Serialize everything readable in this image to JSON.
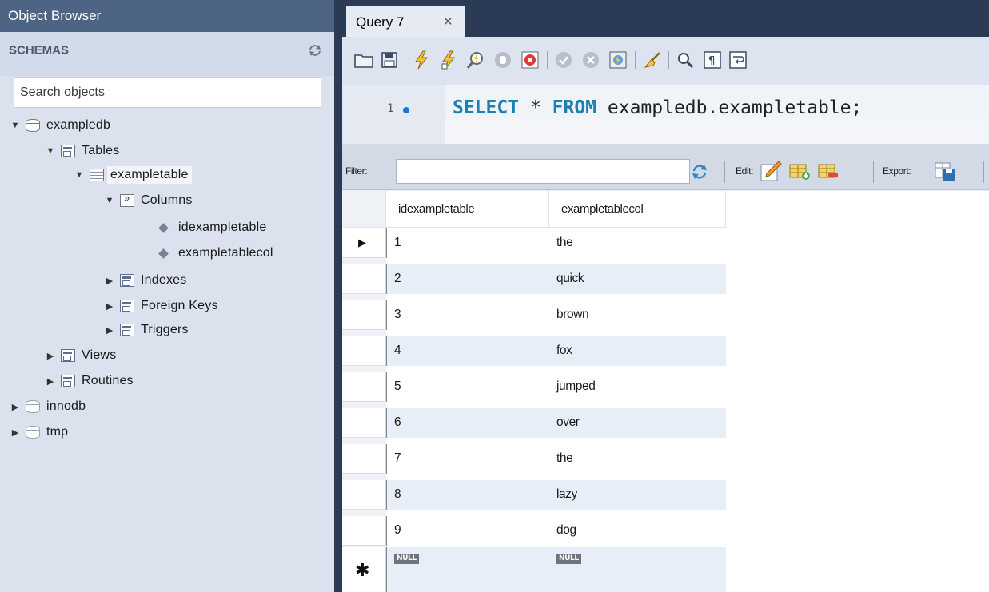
{
  "left_panel": {
    "title": "Object Browser",
    "schemas_label": "SCHEMAS",
    "search_placeholder": "Search objects",
    "tree": {
      "db": "exampledb",
      "tables": "Tables",
      "table": "exampletable",
      "columns": "Columns",
      "col1": "idexampletable",
      "col2": "exampletablecol",
      "indexes": "Indexes",
      "foreign_keys": "Foreign Keys",
      "triggers": "Triggers",
      "views": "Views",
      "routines": "Routines",
      "db2": "innodb",
      "db3": "tmp"
    }
  },
  "tab": {
    "label": "Query 7",
    "close": "✕"
  },
  "editor": {
    "line_number": "1",
    "kw_select": "SELECT",
    "star": " * ",
    "kw_from": "FROM",
    "rest": " exampledb.exampletable;"
  },
  "result_toolbar": {
    "filter_label": "Filter:",
    "edit_label": "Edit:",
    "export_label": "Export:"
  },
  "grid": {
    "headers": [
      "idexampletable",
      "exampletablecol"
    ],
    "rows": [
      {
        "id": "1",
        "col": "the"
      },
      {
        "id": "2",
        "col": "quick"
      },
      {
        "id": "3",
        "col": "brown"
      },
      {
        "id": "4",
        "col": "fox"
      },
      {
        "id": "5",
        "col": "jumped"
      },
      {
        "id": "6",
        "col": "over"
      },
      {
        "id": "7",
        "col": "the"
      },
      {
        "id": "8",
        "col": "lazy"
      },
      {
        "id": "9",
        "col": "dog"
      }
    ],
    "null_text": "NULL",
    "current_row_marker": "▶",
    "new_row_marker": "✱"
  }
}
